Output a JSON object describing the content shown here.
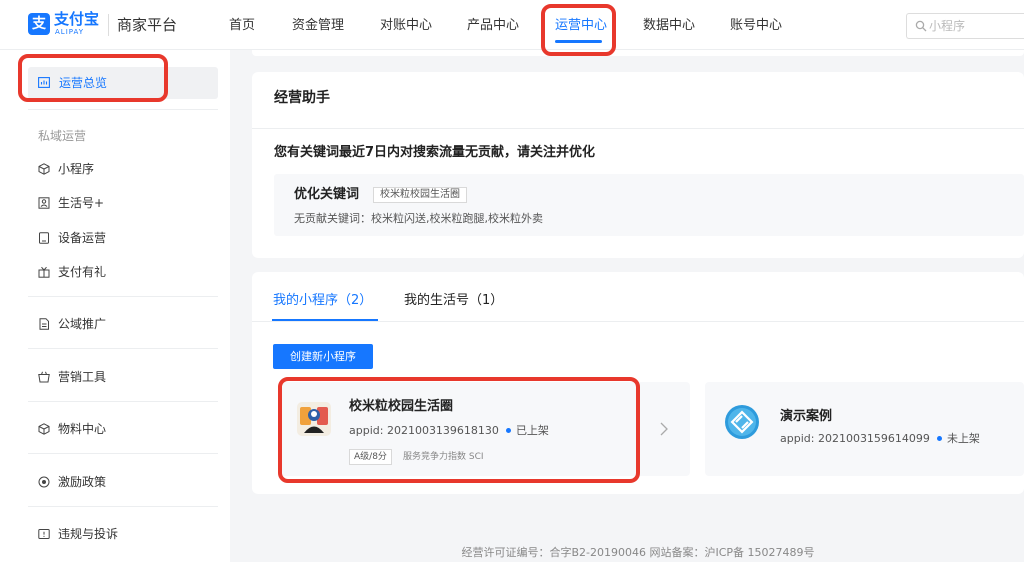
{
  "header": {
    "logo_text": "支付宝",
    "logo_sub": "ALIPAY",
    "platform": "商家平台",
    "nav": [
      "首页",
      "资金管理",
      "对账中心",
      "产品中心",
      "运营中心",
      "数据中心",
      "账号中心"
    ],
    "active_nav": "运营中心",
    "search_placeholder": "小程序"
  },
  "sidebar": {
    "overview": "运营总览",
    "group_private": "私域运营",
    "private_items": [
      "小程序",
      "生活号+",
      "设备运营",
      "支付有礼"
    ],
    "public_promo": "公域推广",
    "marketing_tools": "营销工具",
    "material_center": "物料中心",
    "incentive_policy": "激励政策",
    "violation": "违规与投诉"
  },
  "assistant": {
    "title": "经营助手",
    "notice": "您有关键词最近7日内对搜索流量无贡献，请关注并优化",
    "keyword_label": "优化关键词",
    "keyword_tag": "校米粒校园生活圈",
    "useless_keywords": "无贡献关键词：校米粒闪送,校米粒跑腿,校米粒外卖"
  },
  "apps": {
    "tab_mini": "我的小程序（2）",
    "tab_life": "我的生活号（1）",
    "create_button": "创建新小程序",
    "cards": [
      {
        "name": "校米粒校园生活圈",
        "appid": "appid: 2021003139618130",
        "status": "已上架",
        "grade": "A级/8分",
        "grade_desc": "服务竞争力指数 SCI"
      },
      {
        "name": "演示案例",
        "appid": "appid: 2021003159614099",
        "status": "未上架"
      }
    ]
  },
  "footer": "经营许可证编号：合字B2-20190046 网站备案：沪ICP备 15027489号",
  "colors": {
    "accent": "#1677ff",
    "highlight": "#e8382c"
  }
}
